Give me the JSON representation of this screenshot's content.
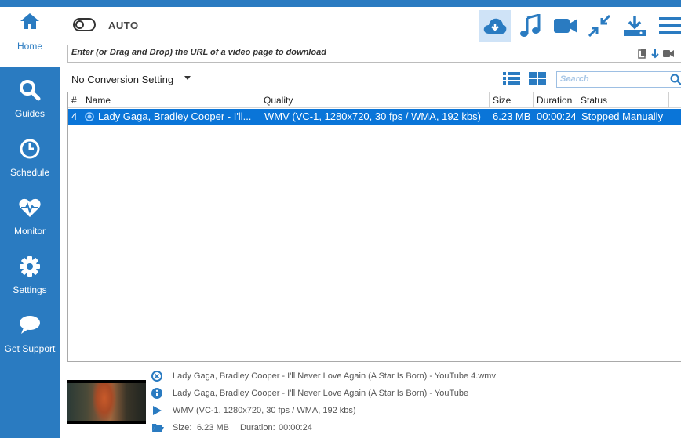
{
  "sidebar": {
    "items": [
      {
        "label": "Home",
        "icon": "home-icon"
      },
      {
        "label": "Guides",
        "icon": "search-icon"
      },
      {
        "label": "Schedule",
        "icon": "clock-icon"
      },
      {
        "label": "Monitor",
        "icon": "heartbeat-icon"
      },
      {
        "label": "Settings",
        "icon": "gear-icon"
      },
      {
        "label": "Get Support",
        "icon": "chat-bubble-icon"
      }
    ]
  },
  "header": {
    "auto_label": "AUTO",
    "url_placeholder": "Enter (or Drag and Drop) the URL of a video page to download"
  },
  "toolbar": {
    "buttons": [
      "cloud-download-icon",
      "music-note-icon",
      "video-camera-icon",
      "compress-arrows-icon",
      "download-tray-icon",
      "hamburger-menu-icon"
    ]
  },
  "conversion": {
    "selected": "No Conversion Setting"
  },
  "search": {
    "placeholder": "Search"
  },
  "table": {
    "columns": [
      "#",
      "Name",
      "Quality",
      "Size",
      "Duration",
      "Status"
    ],
    "rows": [
      {
        "num": "4",
        "name": "Lady Gaga, Bradley Cooper - I'll...",
        "quality": "WMV (VC-1, 1280x720, 30 fps / WMA, 192 kbs)",
        "size": "6.23 MB",
        "duration": "00:00:24",
        "status": "Stopped Manually"
      }
    ]
  },
  "details": {
    "file_name": "Lady Gaga, Bradley Cooper - I'll Never Love Again (A Star Is Born) - YouTube 4.wmv",
    "title": "Lady Gaga, Bradley Cooper - I'll Never Love Again (A Star Is Born) - YouTube",
    "quality": "WMV (VC-1, 1280x720, 30 fps / WMA, 192 kbs)",
    "size_label": "Size:",
    "size_value": "6.23 MB",
    "duration_label": "Duration:",
    "duration_value": "00:00:24"
  },
  "colors": {
    "accent": "#2a7bc1",
    "selection": "#0a75d8",
    "toolbar_active": "#cfe3f7"
  }
}
